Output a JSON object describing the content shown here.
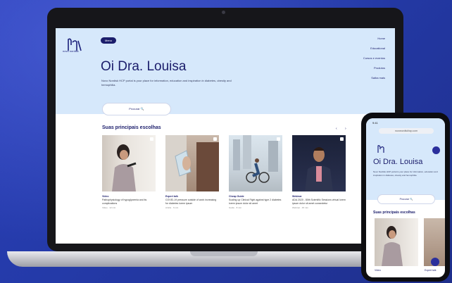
{
  "desktop": {
    "brand": "novo nordisk",
    "pill": "Menu",
    "nav": [
      "Home",
      "Educational",
      "Cursos e eventos",
      "Produtos",
      "Saiba mais"
    ],
    "greeting": "Oi Dra. Louisa",
    "subtitle": "Novo Nordisk HCP portal is your place for information, education and inspiration in diabetes, obesity and hemophilia.",
    "search_label": "Procurar 🔍",
    "section_title": "Suas principais escolhas",
    "arrows": "‹ ›",
    "cards": [
      {
        "type": "Video",
        "title": "Pathophysiology of hypoglycemia and its complications",
        "meta": "Video · 12 min"
      },
      {
        "type": "Expert talk",
        "title": "COVID-19 pressure outside of work increasing for diabetes lorem ipsum",
        "meta": "Article · 6 min"
      },
      {
        "type": "Cheap Guide",
        "title": "Scaling up Clinical Fight against type 2 diabetes lorem ipsum dolor sit amet",
        "meta": "Guide · 8 min"
      },
      {
        "type": "Webinar",
        "title": "ADA 2020 - 80th Scientific Sessions virtual lorem ipsum dolor sit amet consectetur",
        "meta": "Webinar · 45 min"
      }
    ]
  },
  "mobile": {
    "status": "9:41",
    "url": "novonordiskhcp.com",
    "greeting": "Oi Dra. Louisa",
    "subtitle": "Novo Nordisk HCP portal is your place for information, education and inspiration in diabetes, obesity and hemophilia.",
    "search_label": "Procurar 🔍",
    "section_title": "Suas principais escolhas",
    "card_types": [
      "Video",
      "Expert talk"
    ]
  },
  "colors": {
    "navy": "#1b1d6b",
    "hero": "#d6e8fb",
    "background": "#2a3fb8"
  }
}
